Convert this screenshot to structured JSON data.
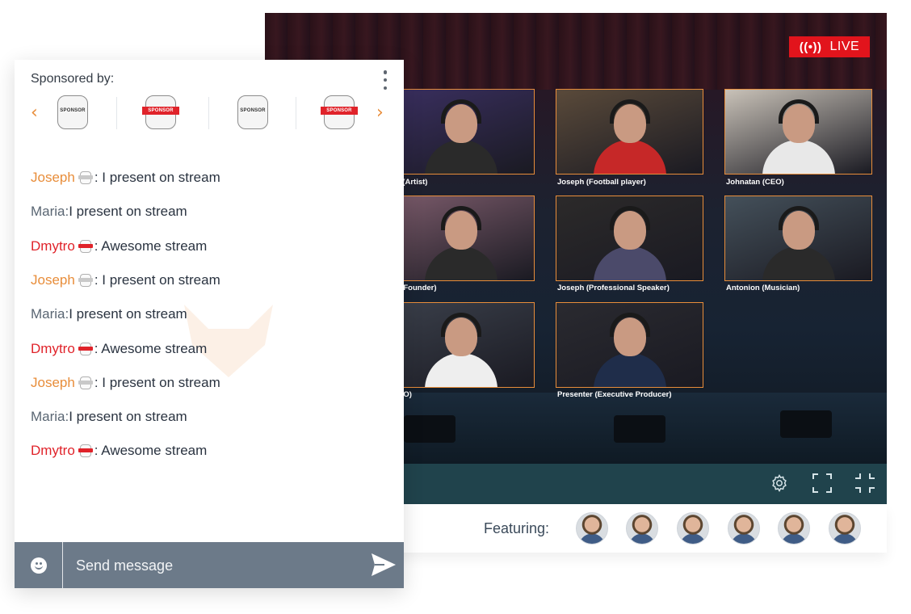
{
  "stream": {
    "live_label": "LIVE",
    "live_icon": "broadcast-icon",
    "participants": [
      {
        "label": "tro (Artist)",
        "shirt": "#2a2a2a",
        "bg": "#3a2f60"
      },
      {
        "label": "Joseph (Football player)",
        "shirt": "#c62828",
        "bg": "#5a4a3a"
      },
      {
        "label": "Johnatan (CEO)",
        "shirt": "#e8e8e8",
        "bg": "#c9c2b8"
      },
      {
        "label": "sa (Founder)",
        "shirt": "#2a2a2a",
        "bg": "#7a5a6a"
      },
      {
        "label": "Joseph (Professional Speaker)",
        "shirt": "#4b4a6a",
        "bg": "#2c2a2a"
      },
      {
        "label": "Antonion (Musician)",
        "shirt": "#2a2a2a",
        "bg": "#44505a"
      },
      {
        "label": "(CEO)",
        "shirt": "#eeeeee",
        "bg": "#3a3f4a"
      },
      {
        "label": "Presenter (Executive Producer)",
        "shirt": "#1f2d4a",
        "bg": "#2a2a30"
      }
    ],
    "controls": {
      "settings_icon": "gear-icon",
      "fullscreen_icon": "fullscreen-icon",
      "exit_fullscreen_icon": "exit-fullscreen-icon"
    }
  },
  "featuring": {
    "label": "Featuring:",
    "avatars": [
      "avatar-1",
      "avatar-2",
      "avatar-3",
      "avatar-4",
      "avatar-5",
      "avatar-6"
    ]
  },
  "chat": {
    "sponsored_label": "Sponsored by:",
    "sponsors": [
      {
        "band_text": "SPONSOR",
        "style": "gray"
      },
      {
        "band_text": "SPONSOR",
        "style": "red"
      },
      {
        "band_text": "SPONSOR",
        "style": "gray"
      },
      {
        "band_text": "SPONSOR",
        "style": "red"
      }
    ],
    "messages": [
      {
        "name": "Joseph",
        "color": "orange",
        "badge": "gray",
        "text": ": I present on stream"
      },
      {
        "name": "Maria:",
        "color": "gray",
        "badge": "",
        "text": " I present on stream"
      },
      {
        "name": "Dmytro",
        "color": "red",
        "badge": "red",
        "text": ": Awesome stream"
      },
      {
        "name": "Joseph",
        "color": "orange",
        "badge": "gray",
        "text": ": I present on stream"
      },
      {
        "name": "Maria:",
        "color": "gray",
        "badge": "",
        "text": " I present on stream"
      },
      {
        "name": "Dmytro",
        "color": "red",
        "badge": "red",
        "text": ": Awesome stream"
      },
      {
        "name": "Joseph",
        "color": "orange",
        "badge": "gray",
        "text": ": I present on stream"
      },
      {
        "name": "Maria:",
        "color": "gray",
        "badge": "",
        "text": " I present on stream"
      },
      {
        "name": "Dmytro",
        "color": "red",
        "badge": "red",
        "text": ": Awesome stream"
      }
    ],
    "input_placeholder": "Send message"
  },
  "colors": {
    "accent_orange": "#e88d3a",
    "live_red": "#e2141c",
    "name_red": "#e0232a",
    "controls_bar": "#20434c",
    "chat_bar": "#6c7a89"
  }
}
